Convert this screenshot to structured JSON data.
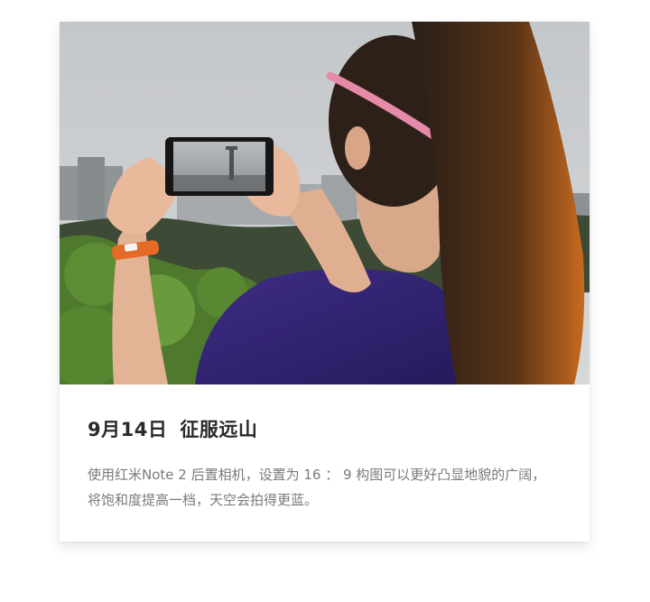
{
  "card": {
    "photo": {
      "description_icon": "photo-of-woman-photographing-tower"
    },
    "title": {
      "date": "9月14日",
      "heading": "征服远山"
    },
    "description_lines": [
      "使用红米Note 2 后置相机，设置为 16 ： 9 构图可以更好凸显地貌的广阔，",
      "将饱和度提高一档，天空会拍得更蓝。"
    ]
  },
  "colors": {
    "title": "#2a2a2a",
    "text": "#7a7a7a",
    "background": "#ffffff"
  }
}
